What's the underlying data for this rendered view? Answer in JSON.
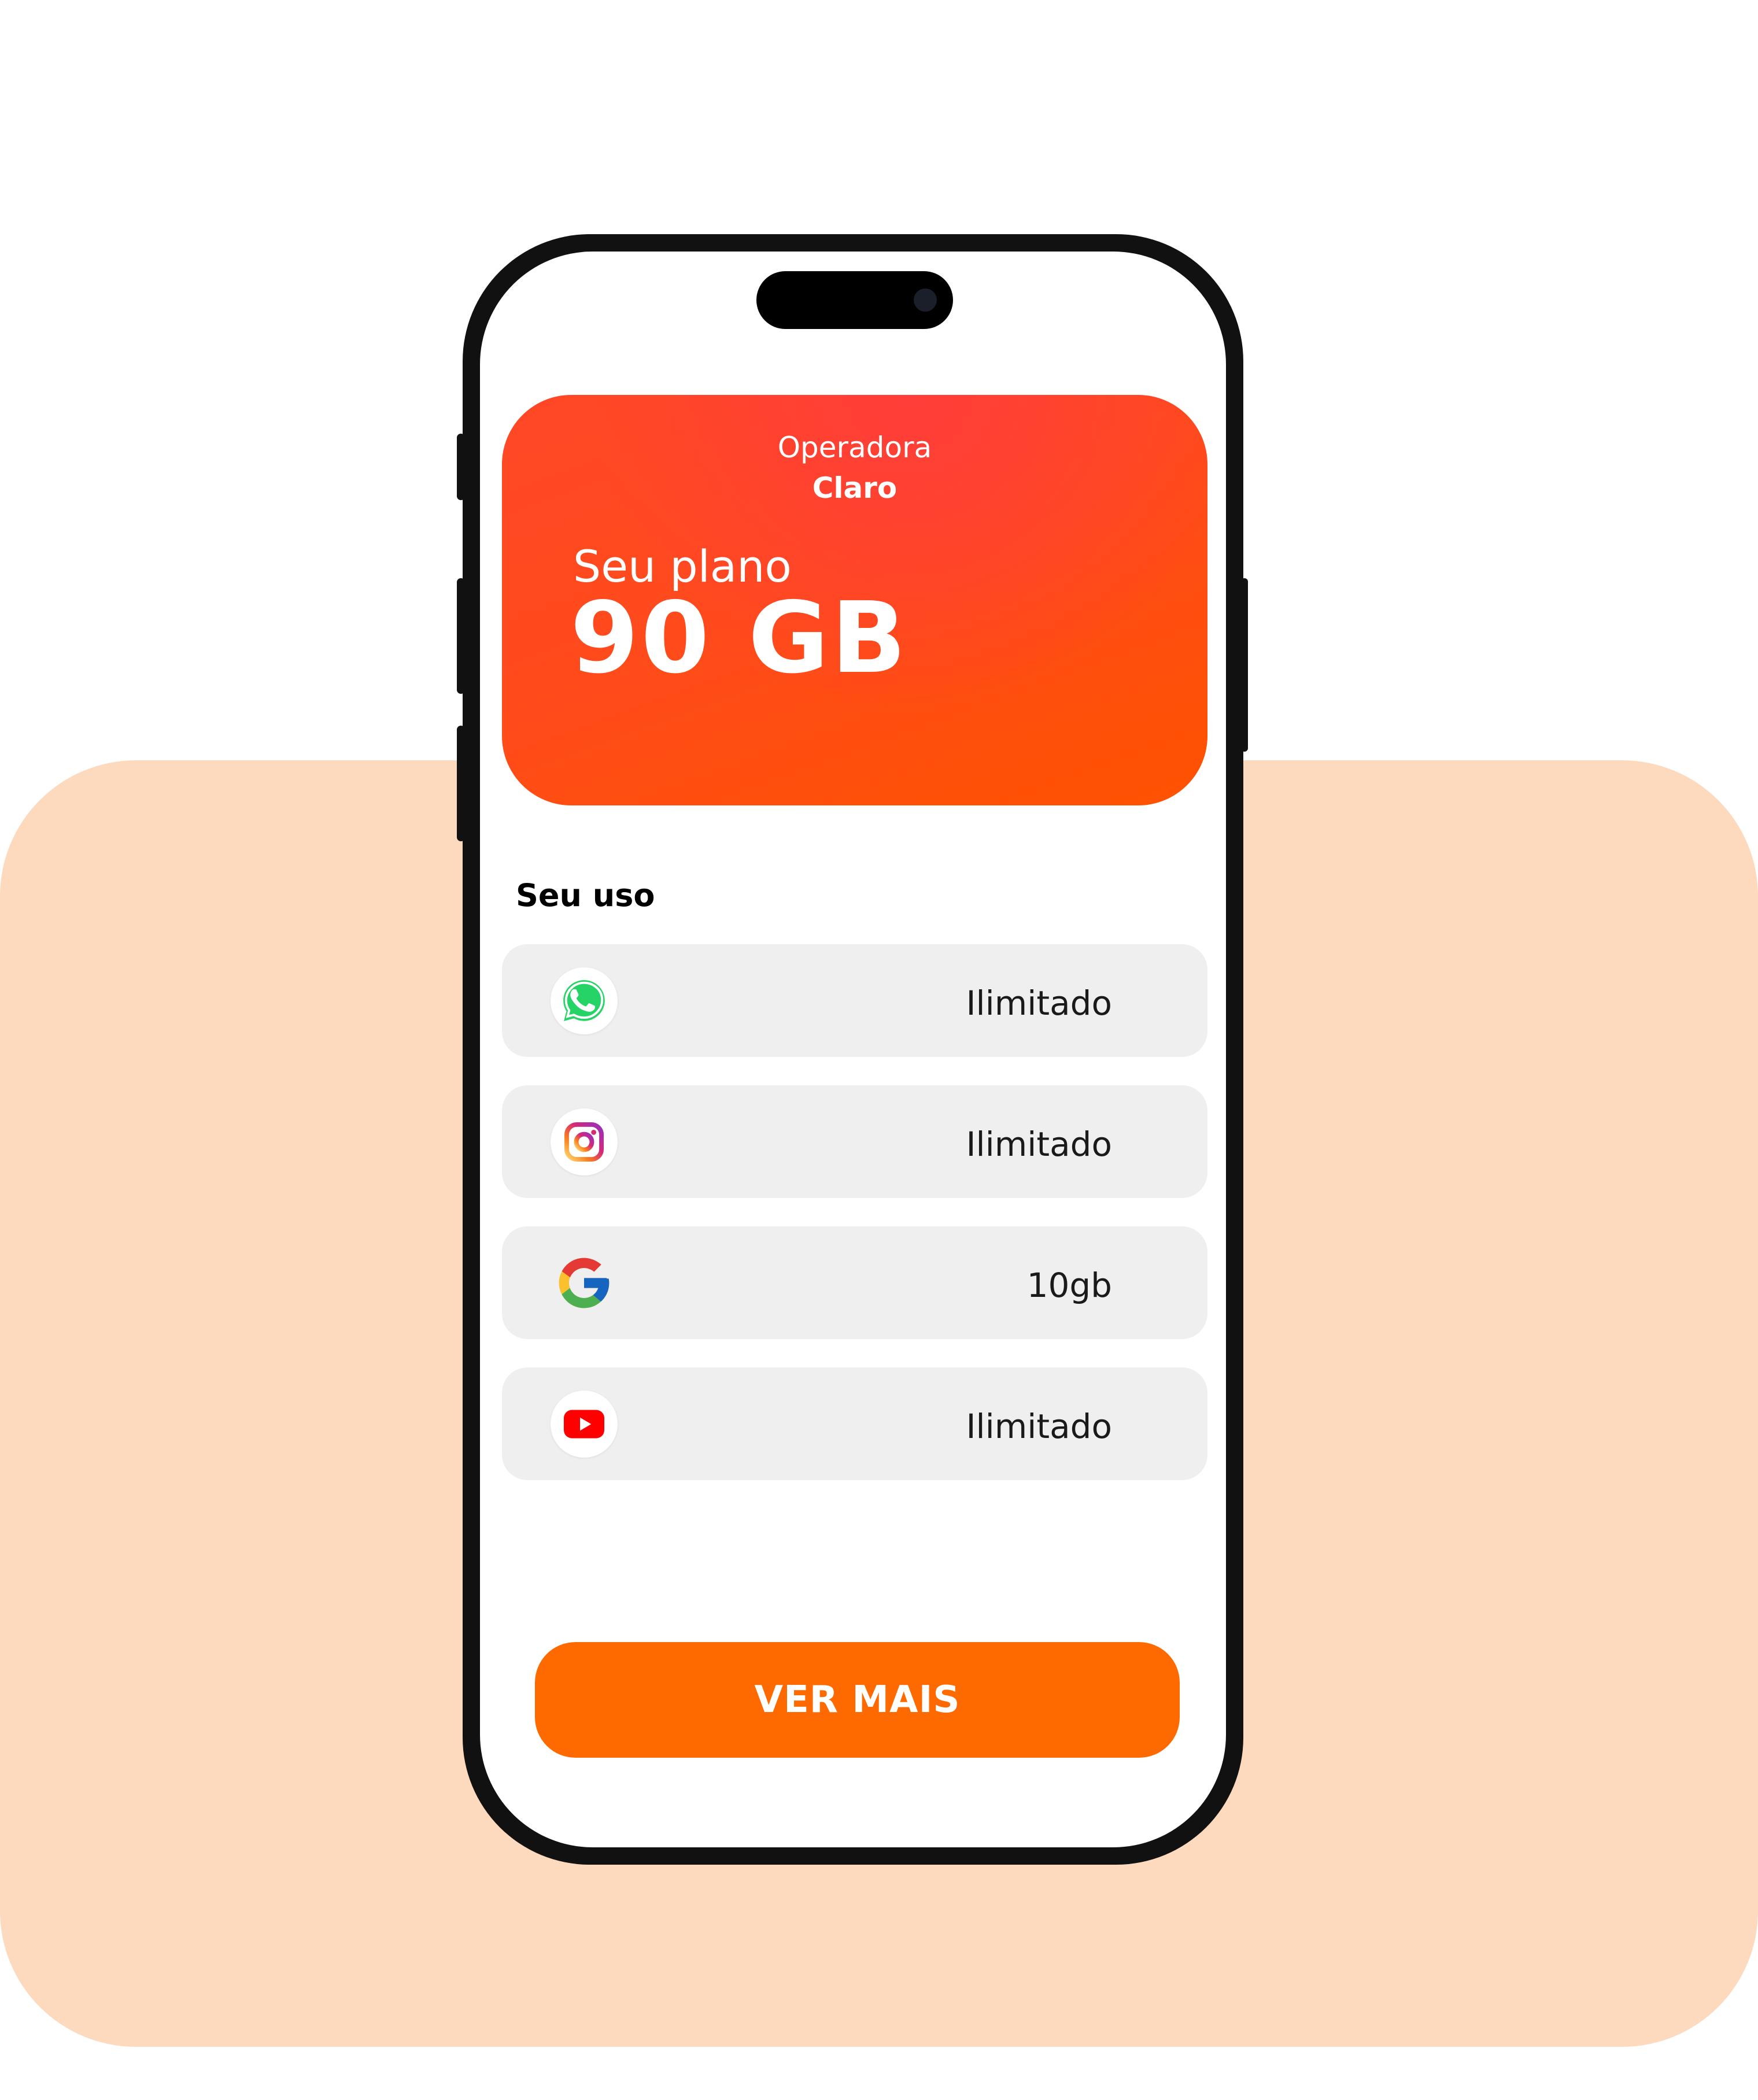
{
  "plan": {
    "operator_label": "Operadora",
    "operator_name": "Claro",
    "plan_label": "Seu plano",
    "plan_value": "90 GB"
  },
  "usage": {
    "title": "Seu uso",
    "items": [
      {
        "app": "WhatsApp",
        "icon": "whatsapp-icon",
        "value": "Ilimitado"
      },
      {
        "app": "Instagram",
        "icon": "instagram-icon",
        "value": "Ilimitado"
      },
      {
        "app": "Google",
        "icon": "google-icon",
        "value": "10gb"
      },
      {
        "app": "YouTube",
        "icon": "youtube-icon",
        "value": "Ilimitado"
      }
    ]
  },
  "cta": {
    "label": "VER MAIS"
  },
  "colors": {
    "background_accent": "#fdd9bd",
    "plan_card_gradient": [
      "#ff3d3a",
      "#ff5200"
    ],
    "cta": "#ff6a00",
    "row_background": "#efefef"
  }
}
